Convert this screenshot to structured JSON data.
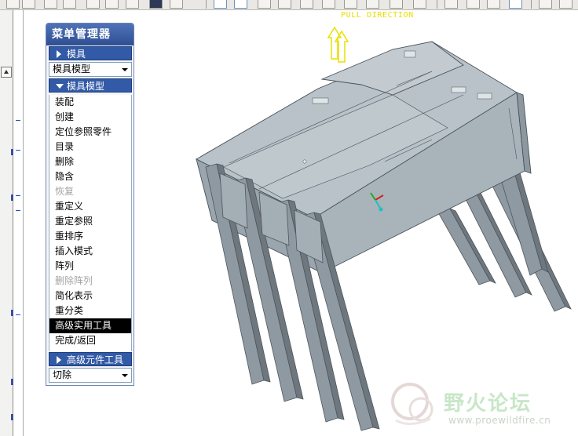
{
  "viewport": {
    "pull_direction_label": "PULL DIRECTION"
  },
  "menu_manager": {
    "title": "菜单管理器",
    "sections": {
      "mold": "模具",
      "mold_model": "模具模型",
      "adv_component_tools": "高级元件工具"
    },
    "mold_select_value": "模具模型",
    "cut_select_value": "切除",
    "items": [
      {
        "label": "装配",
        "state": "enabled"
      },
      {
        "label": "创建",
        "state": "enabled"
      },
      {
        "label": "定位参照零件",
        "state": "enabled"
      },
      {
        "label": "目录",
        "state": "enabled"
      },
      {
        "label": "删除",
        "state": "enabled"
      },
      {
        "label": "隐含",
        "state": "enabled"
      },
      {
        "label": "恢复",
        "state": "disabled"
      },
      {
        "label": "重定义",
        "state": "enabled"
      },
      {
        "label": "重定参照",
        "state": "enabled"
      },
      {
        "label": "重排序",
        "state": "enabled"
      },
      {
        "label": "插入模式",
        "state": "enabled"
      },
      {
        "label": "阵列",
        "state": "enabled"
      },
      {
        "label": "删除阵列",
        "state": "disabled"
      },
      {
        "label": "简化表示",
        "state": "enabled"
      },
      {
        "label": "重分类",
        "state": "enabled"
      },
      {
        "label": "高级实用工具",
        "state": "selected"
      },
      {
        "label": "完成/返回",
        "state": "enabled"
      }
    ]
  },
  "watermark": {
    "site_name": "野火论坛",
    "url": "www.proewildfire.cn"
  },
  "colors": {
    "menu_header": "#325aa6",
    "model_top": "#b7c0c6",
    "model_side": "#9aa5ad",
    "model_leg": "#8d979f",
    "pull_arrow": "#e8e000"
  }
}
